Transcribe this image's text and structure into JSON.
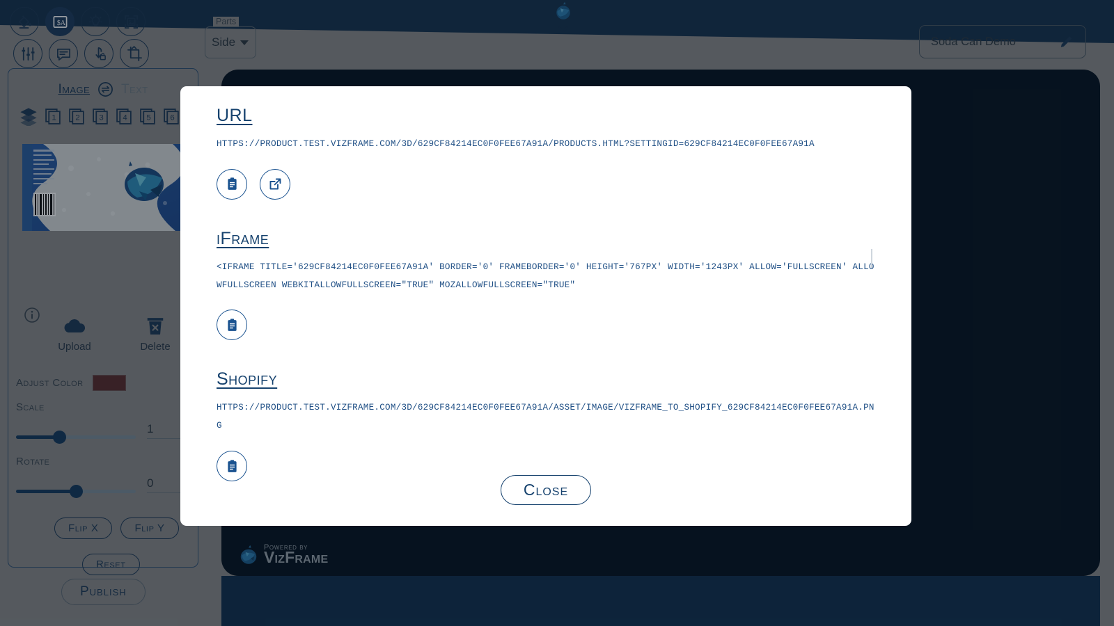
{
  "header": {
    "parts_legend": "Parts",
    "parts_value": "Side",
    "project_name": "Soda Can Demo",
    "edit_icon": "pencil-icon",
    "logo_icon": "pomegranate-logo-icon",
    "collapse_icon": "chevron-down-icon"
  },
  "toolbar": {
    "items": [
      {
        "name": "paint-bucket-icon",
        "label": "Fill Color",
        "active": false
      },
      {
        "name": "currency-text-icon",
        "label": "Price Text",
        "active": true
      },
      {
        "name": "lightbulb-icon",
        "label": "Lighting",
        "active": false
      },
      {
        "name": "image-frame-icon",
        "label": "Background Image",
        "active": false
      },
      {
        "name": "sliders-icon",
        "label": "Adjustments",
        "active": false
      },
      {
        "name": "comment-icon",
        "label": "Comments",
        "active": false
      },
      {
        "name": "lock-drop-icon",
        "label": "Lock Drop",
        "active": false
      },
      {
        "name": "crop-icon",
        "label": "Crop",
        "active": false
      }
    ]
  },
  "panel": {
    "tabs": {
      "image_label": "Image",
      "swap_icon": "swap-horizontal-icon",
      "text_label": "Text"
    },
    "layers": {
      "stack_icon": "layers-stack-icon",
      "numbers": [
        "1",
        "2",
        "3",
        "4",
        "5",
        "6"
      ]
    },
    "info_icon": "info-circle-icon",
    "upload": {
      "icon": "cloud-upload-icon",
      "label": "Upload"
    },
    "delete": {
      "icon": "trash-delete-icon",
      "label": "Delete"
    },
    "adjust_color": {
      "label": "Adjust Color",
      "swatch_hex": "#5a2b2b"
    },
    "scale": {
      "label": "Scale",
      "value": "1",
      "percent": 36
    },
    "rotate": {
      "label": "Rotate",
      "value": "0",
      "percent": 50
    },
    "flip_x": "Flip X",
    "flip_y": "Flip Y",
    "reset": "Reset",
    "publish": "Publish"
  },
  "branding": {
    "powered_by": "Powered by",
    "brand": "VizFrame",
    "logo_icon": "pomegranate-logo-icon"
  },
  "modal": {
    "sections": [
      {
        "title": "URL",
        "content": "https://product.test.vizframe.com/3d/629cf84214ec0f0fee67a91a/products.html?settingId=629cf84214ec0f0fee67a91a",
        "actions": [
          {
            "name": "copy-url-button",
            "icon": "clipboard-icon"
          },
          {
            "name": "open-url-button",
            "icon": "external-link-icon"
          }
        ]
      },
      {
        "title": "iFrame",
        "content": "<iframe title='629cf84214ec0f0fee67a91a' border='0' frameborder='0'  height='767px' width='1243px' allow='fullscreen' allowfullscreen webkitallowfullscreen=\"true\" mozallowfullscreen=\"true\"",
        "actions": [
          {
            "name": "copy-iframe-button",
            "icon": "clipboard-icon"
          }
        ]
      },
      {
        "title": "Shopify",
        "content": "https://product.test.vizframe.com/3d/629cf84214ec0f0fee67a91a/asset/image/vizframe_to_shopify_629cf84214ec0f0fee67a91a.png",
        "actions": [
          {
            "name": "copy-shopify-button",
            "icon": "clipboard-icon"
          }
        ]
      }
    ],
    "close_label": "Close"
  },
  "colors": {
    "brand_navy": "#16426e",
    "link_blue": "#1f4f85",
    "canvas_dark": "#04121f",
    "panel_gray": "#8c8c8c",
    "accent_active": "#1d3c5e"
  }
}
